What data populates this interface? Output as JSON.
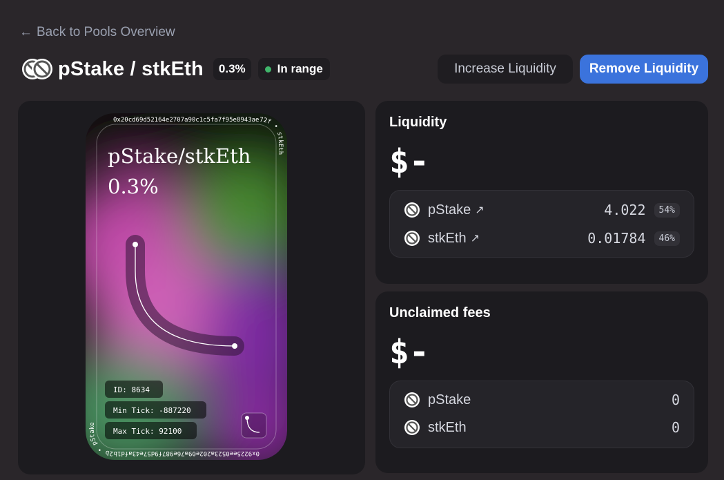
{
  "nav": {
    "back_label": "Back to Pools Overview"
  },
  "pool": {
    "title": "pStake / stkEth",
    "fee": "0.3%",
    "status": "In range",
    "status_color": "#40b66b"
  },
  "actions": {
    "increase_label": "Increase Liquidity",
    "remove_label": "Remove Liquidity",
    "accent": "#3b73dc"
  },
  "nft": {
    "pair_text": "pStake/stkEth",
    "fee_text": "0.3%",
    "top_address": "0x20cd69d52164e2707a90c1c5fa7f95e8943ae72f • stkEth",
    "bottom_address": "0x9225ee0523a202e09a76e987f9d57e43afd1b2b • pStake",
    "id_label": "ID: 8634",
    "min_tick_label": "Min Tick: -887220",
    "max_tick_label": "Max Tick: 92100"
  },
  "liquidity": {
    "title": "Liquidity",
    "value": "$-",
    "tokens": [
      {
        "name": "pStake",
        "arrow": "↗",
        "amount": "4.022",
        "percent": "54%"
      },
      {
        "name": "stkEth",
        "arrow": "↗",
        "amount": "0.01784",
        "percent": "46%"
      }
    ]
  },
  "fees": {
    "title": "Unclaimed fees",
    "value": "$-",
    "tokens": [
      {
        "name": "pStake",
        "amount": "0"
      },
      {
        "name": "stkEth",
        "amount": "0"
      }
    ]
  },
  "icons": {
    "back": "arrow-left-icon",
    "token": "token-placeholder-icon",
    "external": "external-link-icon"
  }
}
